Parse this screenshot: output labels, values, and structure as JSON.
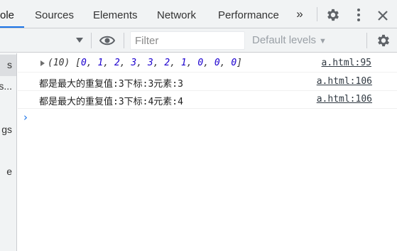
{
  "tabs": [
    {
      "label": "ole",
      "active": true
    },
    {
      "label": "Sources",
      "active": false
    },
    {
      "label": "Elements",
      "active": false
    },
    {
      "label": "Network",
      "active": false
    },
    {
      "label": "Performance",
      "active": false
    }
  ],
  "more_tabs_label": "»",
  "toolbar": {
    "filter_placeholder": "Filter",
    "levels_label": "Default levels",
    "levels_caret": "▼"
  },
  "sidebar": {
    "items": [
      "s",
      "ss...",
      "gs",
      "e"
    ]
  },
  "console": {
    "array_row": {
      "count": "(10)",
      "values": [
        "0",
        "1",
        "2",
        "3",
        "3",
        "2",
        "1",
        "0",
        "0",
        "0"
      ],
      "source": "a.html:95"
    },
    "messages": [
      {
        "text": "都是最大的重复值:3下标:3元素:3",
        "source": "a.html:106"
      },
      {
        "text": "都是最大的重复值:3下标:4元素:4",
        "source": "a.html:106"
      }
    ],
    "prompt": "›"
  },
  "colors": {
    "accent": "#1a73e8",
    "number": "#1c00cf",
    "toolbar_bg": "#f1f3f4"
  }
}
